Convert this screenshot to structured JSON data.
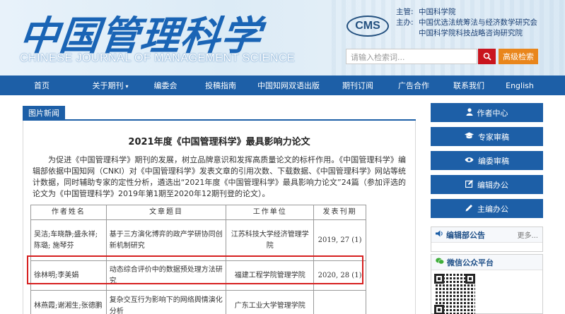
{
  "header": {
    "logo_cn": "中国管理科学",
    "logo_en": "CHINESE JOURNAL OF MANAGEMENT SCIENCE",
    "cms_badge": "CMS",
    "org": [
      {
        "key": "主管:",
        "value": "中国科学院"
      },
      {
        "key": "主办:",
        "value": "中国优选法统筹法与经济数学研究会"
      },
      {
        "key": "",
        "value": "中国科学院科技战略咨询研究院"
      }
    ],
    "search": {
      "placeholder": "请输入检索词...",
      "icon": "search-icon"
    },
    "advanced_search_label": "高级检索"
  },
  "nav": [
    {
      "label": "首页"
    },
    {
      "label": "关于期刊",
      "caret": "▾"
    },
    {
      "label": "编委会"
    },
    {
      "label": "投稿指南"
    },
    {
      "label": "中国知网双语出版"
    },
    {
      "label": "期刊订阅"
    },
    {
      "label": "广告合作"
    },
    {
      "label": "联系我们"
    },
    {
      "label": "English"
    }
  ],
  "main": {
    "tab_label": "图片新闻",
    "article_title": "2021年度《中国管理科学》最具影响力论文",
    "article_body": "为促进《中国管理科学》期刊的发展，树立品牌意识和发挥高质量论文的标杆作用。《中国管理科学》编辑部依据中国知网（CNKI）对《中国管理科学》发表文章的引用次数、下载数据、《中国管理科学》网站等统计数据，同时辅助专家的定性分析，遴选出“2021年度《中国管理科学》最具影响力论文”24篇（参加评选的论文为《中国管理科学》2019年第1期至2020年12期刊登的论文）。",
    "table": {
      "headers": [
        "作者姓名",
        "文章题目",
        "工作单位",
        "发表刊期"
      ],
      "rows": [
        {
          "authors": "吴洁;车晓静;盛永祥;陈璐;  施琴芬",
          "title": "基于三方演化博弈的政产学研协同创新机制研究",
          "org": "江苏科技大学经济管理学院",
          "issue": "2019, 27 (1)"
        },
        {
          "authors": "徐林明;李美娟",
          "title": "动态综合评价中的数据预处理方法研究",
          "org": "福建工程学院管理学院",
          "issue": "2020, 28 (1)"
        },
        {
          "authors": "林燕霞;谢湘生;张德鹏",
          "title": "复杂交互行为影响下的网络舆情演化分析",
          "org": "广东工业大学管理学院",
          "issue": ""
        }
      ]
    }
  },
  "sidebar": {
    "buttons": [
      {
        "label": "作者中心",
        "icon": "user-icon"
      },
      {
        "label": "专家审稿",
        "icon": "graduation-cap-icon"
      },
      {
        "label": "编委审稿",
        "icon": "eye-icon"
      },
      {
        "label": "编辑办公",
        "icon": "edit-icon"
      },
      {
        "label": "主编办公",
        "icon": "pencil-icon"
      }
    ],
    "notice": {
      "title": "编辑部公告",
      "more": "更多..."
    },
    "wechat": {
      "title": "微信公众平台"
    }
  }
}
